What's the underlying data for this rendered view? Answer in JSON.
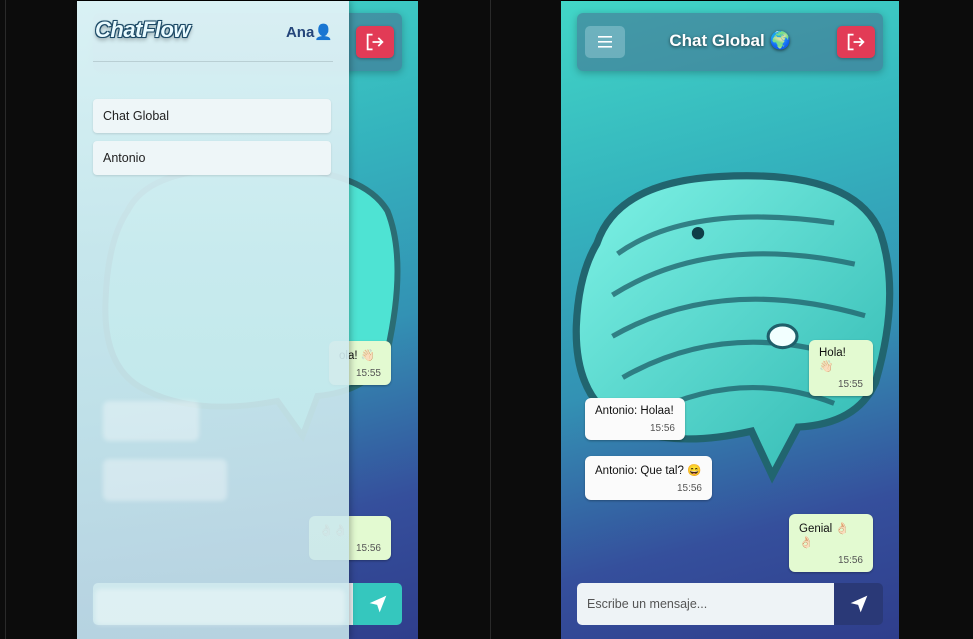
{
  "app": {
    "brand": "ChatFlow",
    "user_name": "Ana",
    "user_icon": "user-icon"
  },
  "sidebar": {
    "chats": [
      {
        "label": "Chat Global"
      },
      {
        "label": "Antonio"
      }
    ]
  },
  "header": {
    "title": "Chat Global 🌍",
    "menu_icon": "hamburger-icon",
    "logout_icon": "logout-icon"
  },
  "messages": [
    {
      "author": "mine",
      "text": "Hola! 👋🏻",
      "time": "15:55"
    },
    {
      "author": "other",
      "text": "Antonio: Holaa!",
      "time": "15:56"
    },
    {
      "author": "other",
      "text": "Antonio: Que tal? 😄",
      "time": "15:56"
    },
    {
      "author": "mine",
      "text": "Genial 👌🏻👌🏻",
      "time": "15:56"
    }
  ],
  "left_visible_messages": [
    {
      "text": "ola! 👋🏻",
      "time": "15:55"
    },
    {
      "text": "👌🏻👌🏻",
      "time": "15:56"
    }
  ],
  "composer": {
    "placeholder": "Escribe un mensaje...",
    "send_icon": "send-icon"
  },
  "colors": {
    "logout": "#e23b56",
    "send_dark": "#2a3977",
    "send_teal": "#35c7be",
    "bubble_mine": "#e3fad1",
    "bubble_other": "#fbfbfb"
  }
}
